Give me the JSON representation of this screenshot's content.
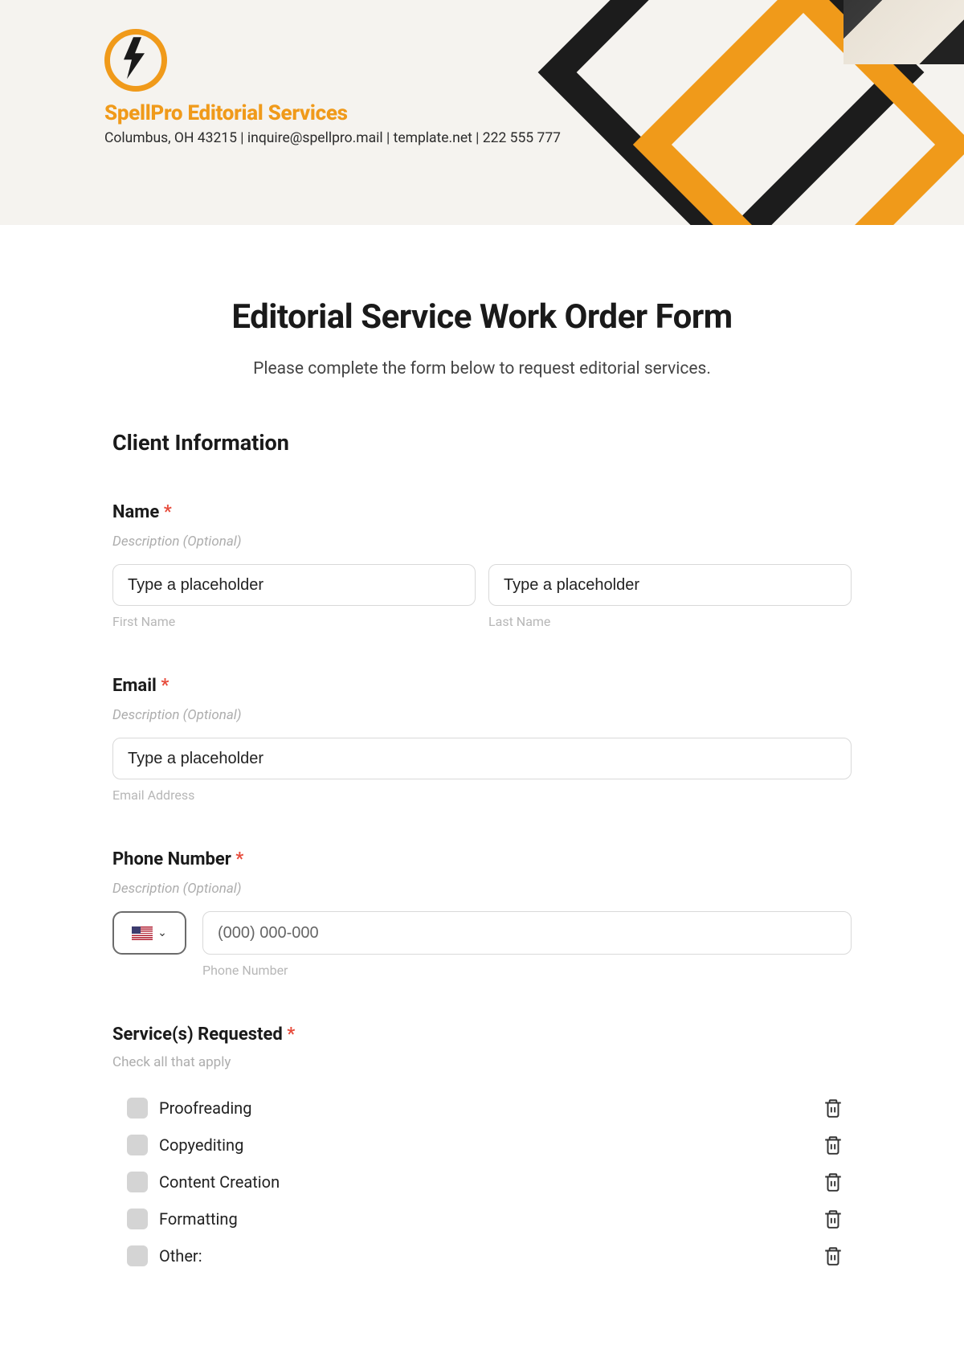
{
  "header": {
    "company_name": "SpellPro Editorial Services",
    "contact_line": "Columbus, OH 43215 | inquire@spellpro.mail | template.net | 222 555 777"
  },
  "form": {
    "title": "Editorial Service Work Order Form",
    "subtitle": "Please complete the form below to request editorial services.",
    "section_client_info": "Client Information",
    "description_hint": "Description (Optional)",
    "name": {
      "label": "Name",
      "first_placeholder": "Type a placeholder",
      "last_placeholder": "Type a placeholder",
      "first_sub": "First Name",
      "last_sub": "Last Name"
    },
    "email": {
      "label": "Email",
      "placeholder": "Type a placeholder",
      "sub": "Email Address"
    },
    "phone": {
      "label": "Phone Number",
      "placeholder": "(000) 000-000",
      "sub": "Phone Number"
    },
    "services": {
      "label": "Service(s) Requested",
      "hint": "Check all that apply",
      "options": [
        "Proofreading",
        "Copyediting",
        "Content Creation",
        "Formatting",
        "Other:"
      ]
    },
    "required_marker": "*"
  }
}
